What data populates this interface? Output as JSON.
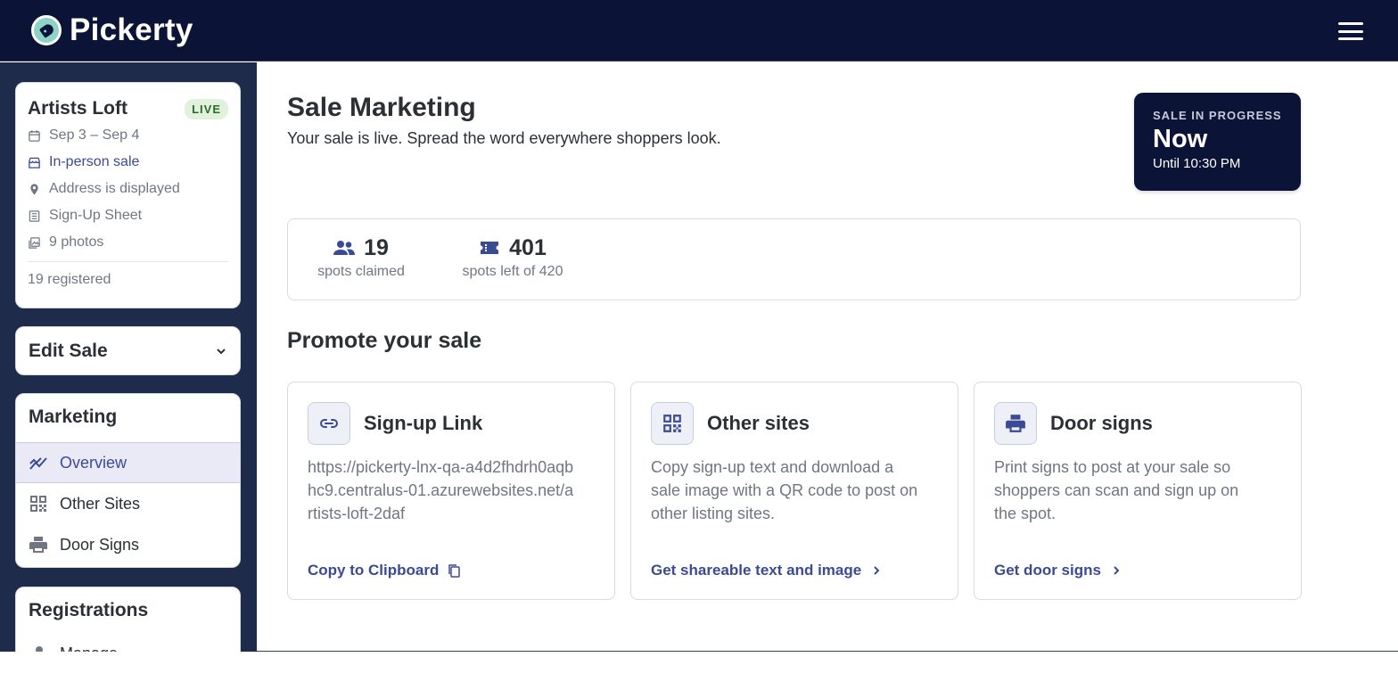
{
  "app": {
    "name": "Pickerty"
  },
  "sale": {
    "name": "Artists Loft",
    "status": "LIVE",
    "dates": "Sep 3 – Sep 4",
    "type": "In-person sale",
    "address": "Address is displayed",
    "signup": "Sign-Up Sheet",
    "photos": "9 photos",
    "registered": "19 registered"
  },
  "sidebar": {
    "edit_sale": "Edit Sale",
    "marketing": {
      "title": "Marketing",
      "items": [
        {
          "label": "Overview",
          "icon": "trend-chart-icon",
          "active": true
        },
        {
          "label": "Other Sites",
          "icon": "qr-code-icon"
        },
        {
          "label": "Door Signs",
          "icon": "printer-icon"
        }
      ]
    },
    "registrations": {
      "title": "Registrations",
      "first_item": "Manage"
    }
  },
  "main": {
    "title": "Sale Marketing",
    "subtitle": "Your sale is live. Spread the word everywhere shoppers look.",
    "progress": {
      "label": "SALE IN PROGRESS",
      "value": "Now",
      "until": "Until 10:30 PM"
    },
    "stats": [
      {
        "value": "19",
        "label": "spots claimed",
        "icon": "people-icon"
      },
      {
        "value": "401",
        "label": "spots left of 420",
        "icon": "ticket-icon"
      }
    ],
    "promote_title": "Promote your sale",
    "cards": [
      {
        "title": "Sign-up Link",
        "body": "https://pickerty-lnx-qa-a4d2fhdrh0aqbhc9.centralus-01.azurewebsites.net/artists-loft-2daf",
        "link": "Copy to Clipboard",
        "icon": "link-icon"
      },
      {
        "title": "Other sites",
        "body": "Copy sign-up text and download a sale image with a QR code to post on other listing sites.",
        "link": "Get shareable text and image",
        "icon": "qr-code-icon"
      },
      {
        "title": "Door signs",
        "body": "Print signs to post at your sale so shoppers can scan and sign up on the spot.",
        "link": "Get door signs",
        "icon": "printer-icon"
      }
    ]
  },
  "colors": {
    "navy": "#0b1437",
    "sidebar": "#1f2b4a",
    "accent": "#3b4a95",
    "live_bg": "#e1f2dc",
    "live_text": "#2e6b2a"
  }
}
